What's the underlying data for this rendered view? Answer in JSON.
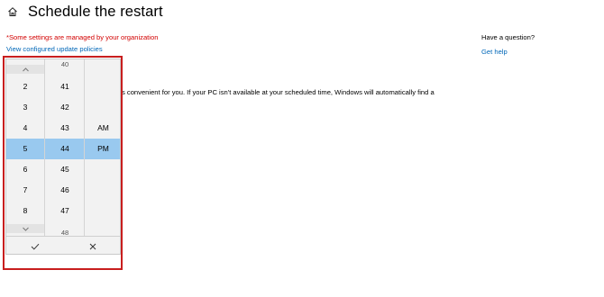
{
  "header": {
    "icon": "home-icon",
    "title": "Schedule the restart"
  },
  "notice": {
    "managed_text": "*Some settings are managed by your organization",
    "managed_color": "#d20000",
    "policies_link": "View configured update policies",
    "link_color": "#0067b8"
  },
  "body": {
    "text": "s convenient for you. If your PC isn't available at your scheduled time, Windows will automatically find a"
  },
  "help": {
    "question": "Have a question?",
    "link": "Get help"
  },
  "picker": {
    "hours": {
      "scroll_up_icon": "chevron-up-icon",
      "scroll_down_icon": "chevron-down-icon",
      "items": [
        "2",
        "3",
        "4",
        "5",
        "6",
        "7",
        "8"
      ],
      "selected": "5"
    },
    "minutes": {
      "items": [
        "40",
        "41",
        "42",
        "43",
        "44",
        "45",
        "46",
        "47",
        "48"
      ],
      "selected": "44"
    },
    "ampm": {
      "items": [
        "AM",
        "PM"
      ],
      "selected": "PM"
    },
    "selected_color": "#99c9ef",
    "accept_icon": "checkmark-icon",
    "cancel_icon": "close-icon"
  }
}
